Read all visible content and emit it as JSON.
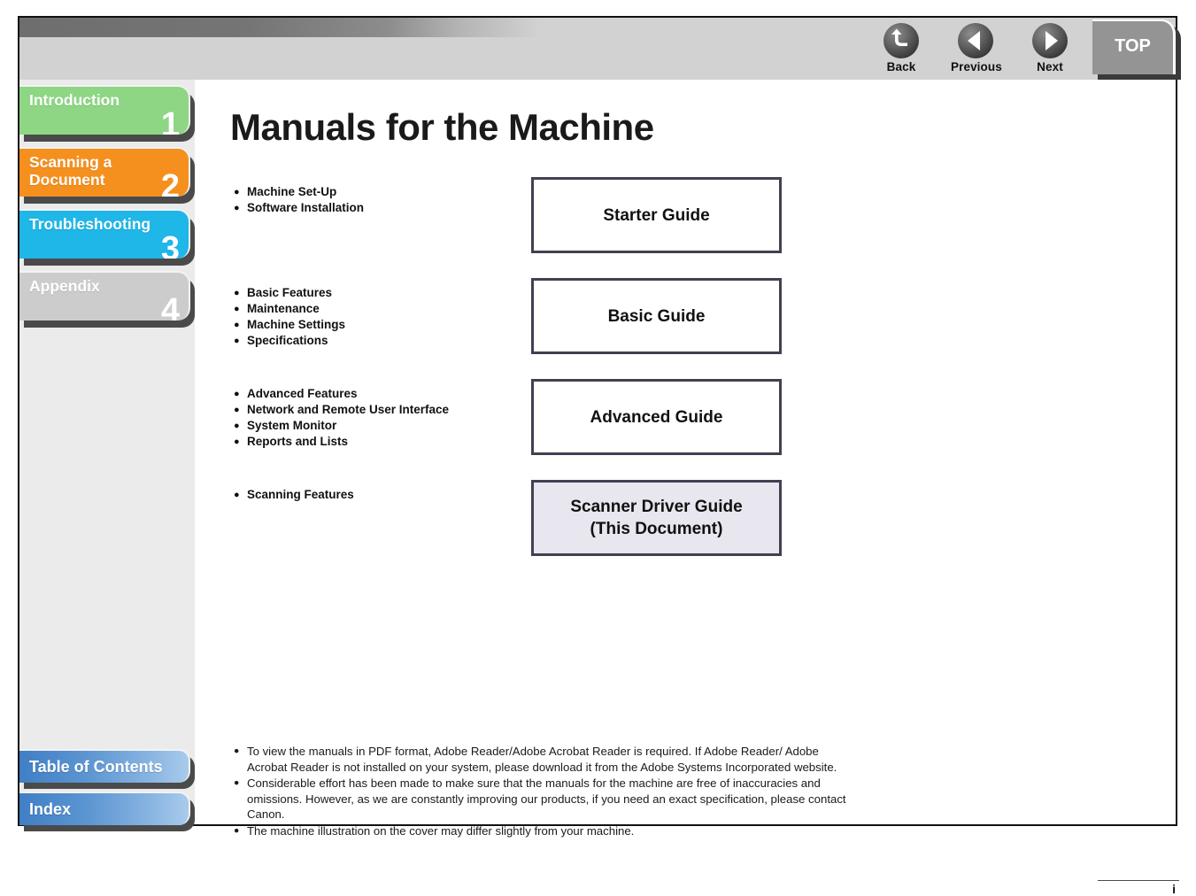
{
  "header": {
    "nav_buttons": [
      {
        "label": "Back",
        "icon": "back-arrow-icon"
      },
      {
        "label": "Previous",
        "icon": "left-triangle-icon"
      },
      {
        "label": "Next",
        "icon": "right-triangle-icon"
      }
    ],
    "top_tab_label": "TOP"
  },
  "sidebar": {
    "chapters": [
      {
        "label": "Introduction",
        "number": "1",
        "color": "#8ed684",
        "active": false
      },
      {
        "label": "Scanning a\nDocument",
        "number": "2",
        "color": "#f5901e",
        "active": false
      },
      {
        "label": "Troubleshooting",
        "number": "3",
        "color": "#1fb6e8",
        "active": false
      },
      {
        "label": "Appendix",
        "number": "4",
        "color": "#cccccc",
        "active": false
      }
    ],
    "bottom_items": [
      {
        "label": "Table of Contents"
      },
      {
        "label": "Index"
      }
    ]
  },
  "main": {
    "title": "Manuals for the Machine",
    "rows": [
      {
        "bullets": [
          "Machine Set-Up",
          "Software Installation"
        ],
        "guide": "Starter Guide",
        "current": false
      },
      {
        "bullets": [
          "Basic Features",
          "Maintenance",
          "Machine Settings",
          "Specifications"
        ],
        "guide": "Basic Guide",
        "current": false
      },
      {
        "bullets": [
          "Advanced Features",
          "Network and Remote User Interface",
          "System Monitor",
          "Reports and Lists"
        ],
        "guide": "Advanced Guide",
        "current": false
      },
      {
        "bullets": [
          "Scanning Features"
        ],
        "guide": "Scanner Driver Guide\n(This Document)",
        "current": true
      }
    ],
    "notes": [
      "To view the manuals in PDF format, Adobe Reader/Adobe Acrobat Reader is required. If Adobe Reader/ Adobe Acrobat Reader is not installed on your system, please download it from the Adobe Systems Incorporated website.",
      "Considerable effort has been made to make sure that the manuals for the machine are free of inaccuracies and omissions. However, as we are constantly improving our products, if you need an exact specification, please contact Canon.",
      "The machine illustration on the cover may differ slightly from your machine."
    ],
    "page_number": "i"
  }
}
